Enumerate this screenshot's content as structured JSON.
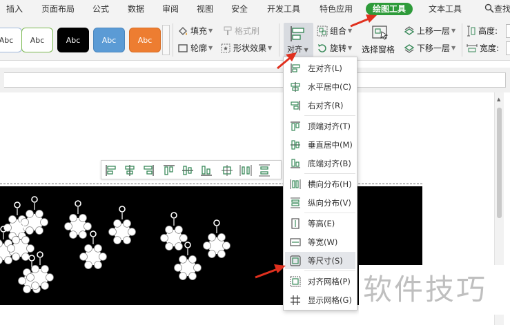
{
  "tabs": [
    {
      "label": "插入"
    },
    {
      "label": "页面布局"
    },
    {
      "label": "公式"
    },
    {
      "label": "数据"
    },
    {
      "label": "审阅"
    },
    {
      "label": "视图"
    },
    {
      "label": "安全"
    },
    {
      "label": "开发工具"
    },
    {
      "label": "特色应用"
    },
    {
      "label": "绘图工具"
    },
    {
      "label": "文本工具"
    },
    {
      "label": "查找"
    }
  ],
  "style_swatches": [
    {
      "label": "Abc",
      "bg": "#ffffff",
      "fg": "#333333",
      "border": "#9fb7da"
    },
    {
      "label": "Abc",
      "bg": "#ffffff",
      "fg": "#333333",
      "border": "#79b84e"
    },
    {
      "label": "Abc",
      "bg": "#000000",
      "fg": "#ffffff",
      "border": "#000000"
    },
    {
      "label": "Abc",
      "bg": "#5b9bd5",
      "fg": "#ffffff",
      "border": "#4a86bd"
    },
    {
      "label": "Abc",
      "bg": "#ed7d31",
      "fg": "#ffffff",
      "border": "#d86c22"
    }
  ],
  "ribbon": {
    "fill": "填充",
    "outline": "轮廓",
    "format_brush": "格式刷",
    "shape_effects": "形状效果",
    "align": "对齐",
    "group": "组合",
    "rotate": "旋转",
    "selection_pane": "选择窗格",
    "bring_forward": "上移一层",
    "send_backward": "下移一层",
    "height": "高度:",
    "width": "宽度:"
  },
  "dropdown": [
    {
      "label": "左对齐(L)",
      "icon": "align-left-icon"
    },
    {
      "label": "水平居中(C)",
      "icon": "align-center-h-icon"
    },
    {
      "label": "右对齐(R)",
      "icon": "align-right-icon"
    },
    {
      "label": "顶端对齐(T)",
      "icon": "align-top-icon"
    },
    {
      "label": "垂直居中(M)",
      "icon": "align-middle-v-icon"
    },
    {
      "label": "底端对齐(B)",
      "icon": "align-bottom-icon"
    },
    {
      "label": "横向分布(H)",
      "icon": "distribute-horizontal-icon"
    },
    {
      "label": "纵向分布(V)",
      "icon": "distribute-vertical-icon"
    },
    {
      "label": "等高(E)",
      "icon": "same-height-icon"
    },
    {
      "label": "等宽(W)",
      "icon": "same-width-icon"
    },
    {
      "label": "等尺寸(S)",
      "icon": "same-size-icon",
      "highlighted": true
    },
    {
      "label": "对齐网格(P)",
      "icon": "snap-to-grid-icon"
    },
    {
      "label": "显示网格(G)",
      "icon": "show-grid-icon"
    }
  ],
  "watermark": "软件技巧",
  "colors": {
    "active_tab": "#2e9b3a",
    "arrow": "#e0301e",
    "icon_green": "#3a8a5a"
  }
}
